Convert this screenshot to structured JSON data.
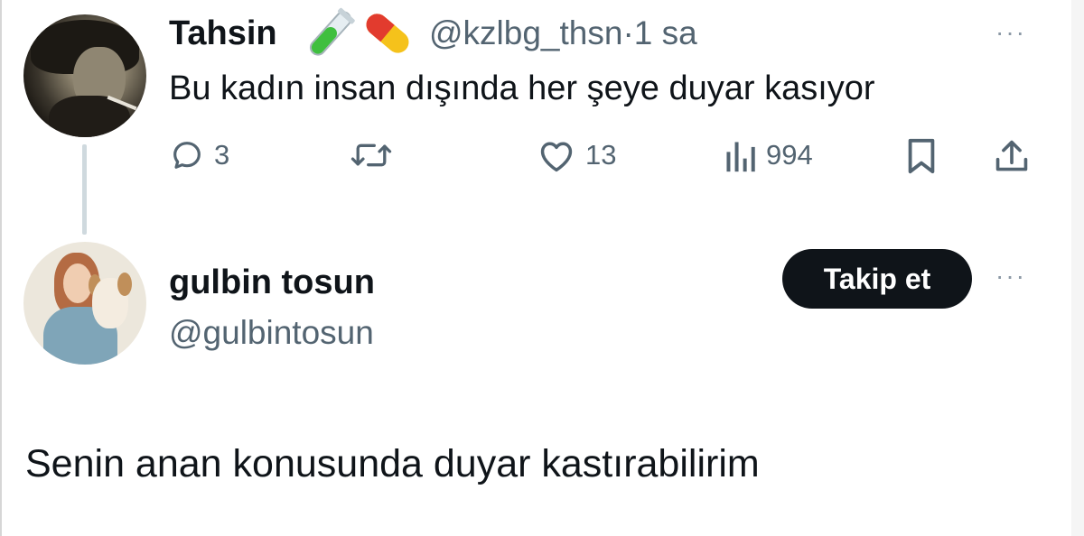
{
  "tweet": {
    "author_name": "Tahsin",
    "author_emojis": [
      "test-tube-icon",
      "pill-icon"
    ],
    "author_handle": "@kzlbg_thsn",
    "separator": "·",
    "time": "1 sa",
    "text": "Bu kadın insan dışında her şeye duyar kasıyor",
    "more": "···",
    "actions": {
      "reply_count": "3",
      "retweet_count": "",
      "like_count": "13",
      "view_count": "994"
    }
  },
  "reply": {
    "author_name": "gulbin tosun",
    "author_handle": "@gulbintosun",
    "follow_label": "Takip et",
    "more": "···",
    "text": "Senin anan konusunda duyar kastırabilirim"
  },
  "colors": {
    "text": "#0f1419",
    "secondary": "#536471",
    "button": "#0f1419",
    "thread_line": "#cfd9de"
  }
}
